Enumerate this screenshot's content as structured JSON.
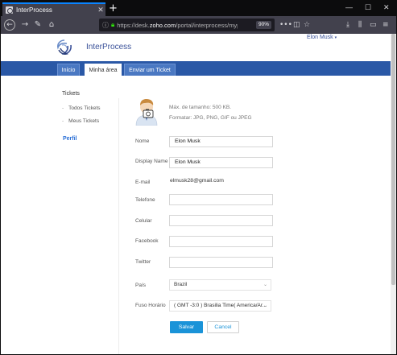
{
  "browser": {
    "tab_title": "InterProcess",
    "new_tab_label": "+",
    "url_prefix": "https://desk.",
    "url_domain": "zoho.com",
    "url_path": "/portal/interprocess/myp...",
    "zoom": "90%",
    "window_controls": {
      "minimize": "—",
      "maximize": "☐",
      "close": "✕"
    }
  },
  "header": {
    "brand": "InterProcess",
    "user_name": "Elon Musk",
    "user_caret": "▾"
  },
  "nav": {
    "tabs": [
      {
        "label": "Início"
      },
      {
        "label": "Minha área"
      },
      {
        "label": "Enviar um Ticket"
      }
    ],
    "active_tab": "Minha área"
  },
  "sidebar": {
    "section_title": "Tickets",
    "items": [
      {
        "label": "Todos Tickets"
      },
      {
        "label": "Meus Tickets"
      }
    ],
    "profile_link": "Perfil"
  },
  "profile": {
    "photo_hints": [
      "Máx. de tamanho: 500 KB.",
      "Formatar: JPG, PNG, GIF ou JPEG"
    ],
    "fields": {
      "nome": {
        "label": "Nome",
        "value": "Elon Musk"
      },
      "display_name": {
        "label": "Display Name",
        "value": "Elon Musk"
      },
      "email": {
        "label": "E-mail",
        "value": "elmusk28@gmail.com"
      },
      "telefone": {
        "label": "Telefone",
        "value": ""
      },
      "celular": {
        "label": "Celular",
        "value": ""
      },
      "facebook": {
        "label": "Facebook",
        "value": ""
      },
      "twitter": {
        "label": "Twitter",
        "value": ""
      },
      "pais": {
        "label": "País",
        "value": "Brazil"
      },
      "fuso": {
        "label": "Fuso Horário",
        "value": "( GMT -3:0 ) Brasilia Time( America/Ar..."
      }
    },
    "save_label": "Salvar",
    "cancel_label": "Cancel"
  },
  "colors": {
    "nav_bar": "#2a58a6",
    "brand_text": "#3a5199",
    "primary_button": "#1a93d8",
    "link": "#2a6fd6"
  }
}
